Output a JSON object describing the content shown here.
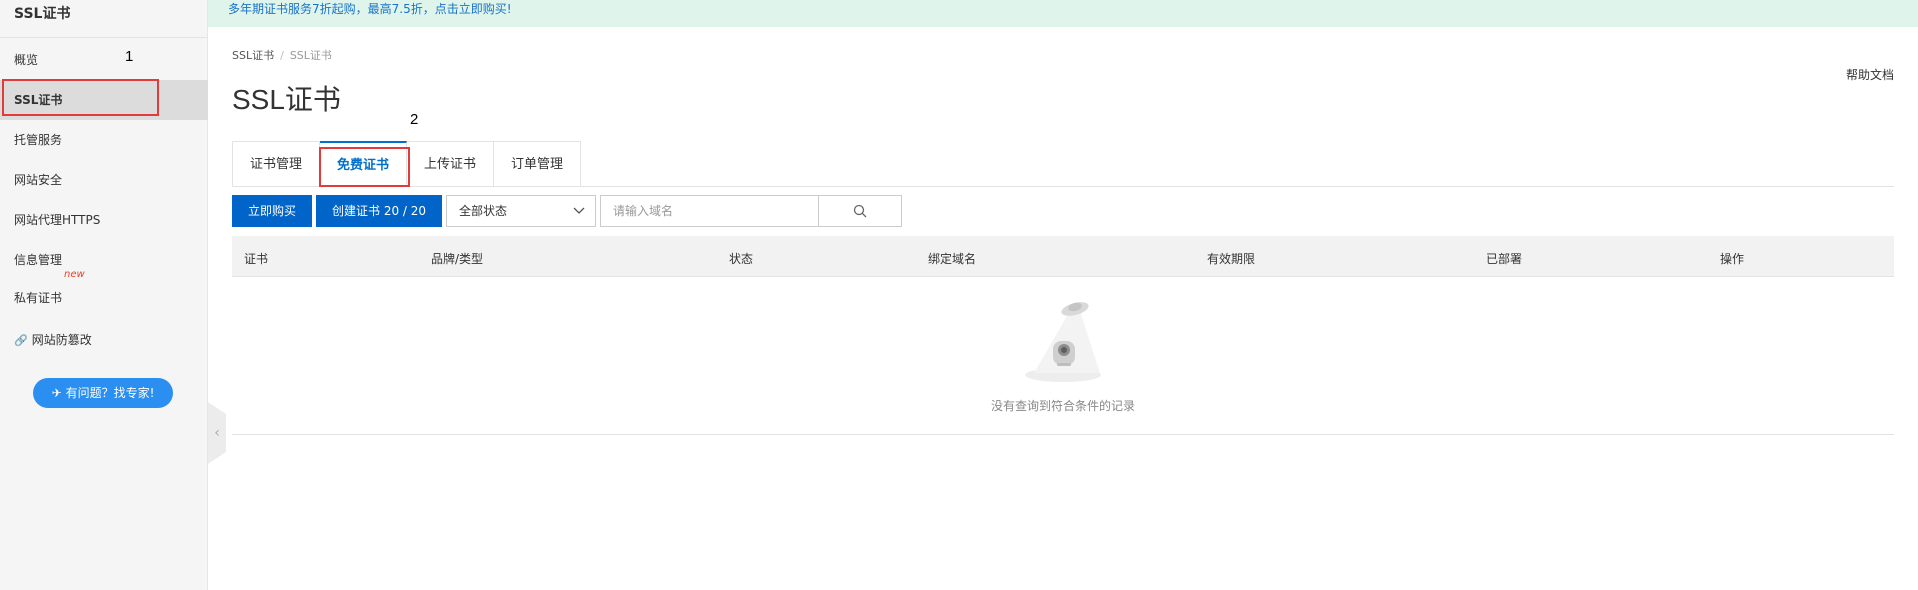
{
  "sidebar": {
    "title": "SSL证书",
    "items": [
      {
        "label": "概览"
      },
      {
        "label": "SSL证书"
      },
      {
        "label": "托管服务"
      },
      {
        "label": "网站安全"
      },
      {
        "label": "网站代理HTTPS"
      },
      {
        "label": "信息管理"
      },
      {
        "label": "私有证书",
        "tag": "new"
      },
      {
        "label": "网站防篡改"
      }
    ],
    "help_button": "有问题？找专家!"
  },
  "banner": {
    "text": "多年期证书服务7折起购，最高7.5折，点击立即购买!"
  },
  "breadcrumb": [
    "SSL证书",
    "SSL证书"
  ],
  "page_title": "SSL证书",
  "help_doc": "帮助文档",
  "annotations": [
    "1",
    "2"
  ],
  "tabs": [
    {
      "label": "证书管理"
    },
    {
      "label": "免费证书"
    },
    {
      "label": "上传证书"
    },
    {
      "label": "订单管理"
    }
  ],
  "toolbar": {
    "buy_label": "立即购买",
    "create_label": "创建证书 20 / 20",
    "status_select": "全部状态",
    "search_placeholder": "请输入域名"
  },
  "table": {
    "columns": [
      "证书",
      "品牌/类型",
      "状态",
      "绑定域名",
      "有效期限",
      "已部署",
      "操作"
    ],
    "empty_text": "没有查询到符合条件的记录"
  }
}
